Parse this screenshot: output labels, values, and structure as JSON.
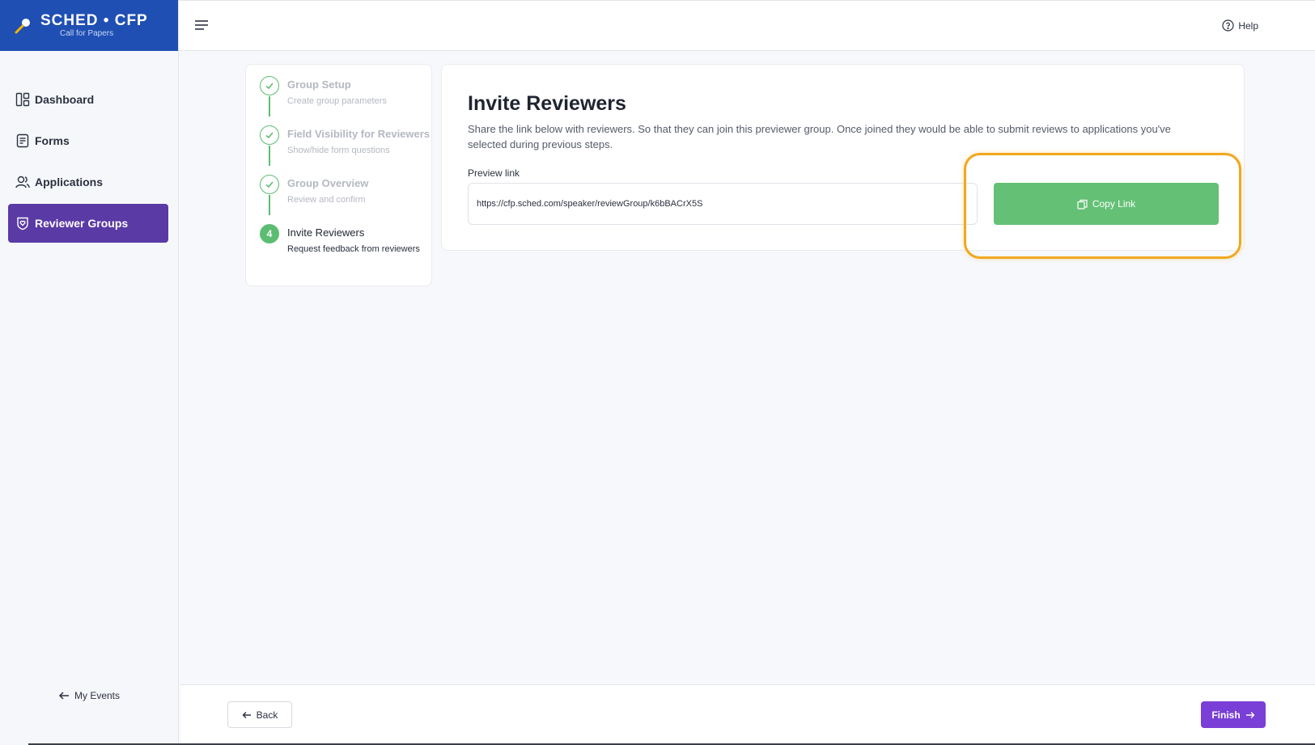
{
  "brand": {
    "title": "SCHED • CFP",
    "subtitle": "Call for Papers"
  },
  "sidebar": {
    "items": [
      {
        "label": "Dashboard",
        "icon": "dashboard-icon"
      },
      {
        "label": "Forms",
        "icon": "forms-icon"
      },
      {
        "label": "Applications",
        "icon": "users-icon"
      },
      {
        "label": "Reviewer Groups",
        "icon": "reviewer-shield-icon",
        "active": true
      }
    ],
    "my_events": "My Events"
  },
  "header": {
    "help": "Help"
  },
  "steps": [
    {
      "title": "Group Setup",
      "desc": "Create group parameters",
      "state": "done"
    },
    {
      "title": "Field Visibility for Reviewers",
      "desc": "Show/hide form questions",
      "state": "done"
    },
    {
      "title": "Group Overview",
      "desc": "Review and confirm",
      "state": "done"
    },
    {
      "number": "4",
      "title": "Invite Reviewers",
      "desc": "Request feedback from reviewers",
      "state": "current"
    }
  ],
  "main": {
    "title": "Invite Reviewers",
    "description": "Share the link below with reviewers. So that they can join this previewer group. Once joined they would be able to submit reviews to applications you've selected during previous steps.",
    "field_label": "Preview link",
    "link_value": "https://cfp.sched.com/speaker/reviewGroup/k6bBACrX5S",
    "copy_label": "Copy Link"
  },
  "footer": {
    "back_label": "Back",
    "finish_label": "Finish"
  },
  "colors": {
    "brand_blue": "#1f4fb3",
    "active_purple": "#5a3aa5",
    "success_green": "#64c075",
    "finish_purple": "#7a3fd6",
    "highlight": "#f0a81e"
  }
}
